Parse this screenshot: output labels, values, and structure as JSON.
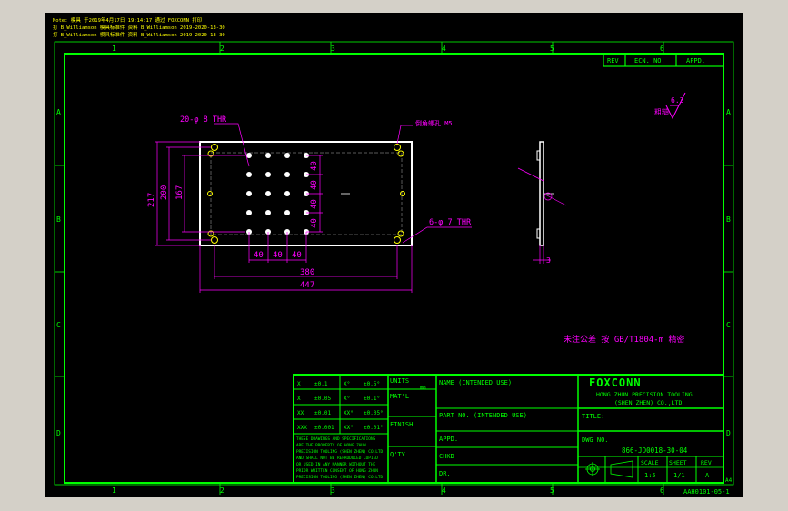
{
  "window": {
    "bg": "#d4d0c8",
    "canvas_bg": "#000000"
  },
  "colors": {
    "border": "#00ff00",
    "part": "#ffffff",
    "dim": "#ff00ff",
    "hole": "#ffff00"
  },
  "header_notes": [
    "Note: 模具 于2019年4月17日 19:14:17 通过 FOXCONN 打印",
    "打 B_Williamson 模具标准件 资料 B_Williamson 2019-2020-13-30",
    "打 B_Williamson 模具标准件 资料 B_Williamson 2019-2020-13-30"
  ],
  "zones": {
    "top": [
      "1",
      "2",
      "3",
      "4",
      "5",
      "6"
    ],
    "bottom": [
      "1",
      "2",
      "3",
      "4",
      "5",
      "6"
    ],
    "left": [
      "A",
      "B",
      "C",
      "D"
    ],
    "right": [
      "A",
      "B",
      "C",
      "D"
    ]
  },
  "revision_table": {
    "rev": "REV",
    "ecn": "ECN. NO.",
    "appd": "APPD."
  },
  "plan_view": {
    "thru_note": "20-φ 8 THR",
    "tap_note": "6-φ 7 THR",
    "corner_note": "倒角螺孔 M5",
    "vertical_dims": [
      "217",
      "200",
      "167"
    ],
    "pitch_v": [
      "40",
      "40",
      "40",
      "40"
    ],
    "pitch_h": [
      "40",
      "40",
      "40"
    ],
    "width_inner": "380",
    "width_outer": "447"
  },
  "side_view": {
    "thickness": "3"
  },
  "surface_finish": {
    "symbol_label": "粗糙",
    "value": "6.3"
  },
  "tech_note": "未注公差 按 GB/T1804-m 精密",
  "title_block": {
    "tol_rows": [
      [
        "X",
        "±0.1",
        "X°",
        "±0.5°"
      ],
      [
        "X",
        "±0.05",
        "X°",
        "±0.1°"
      ],
      [
        "XX",
        "±0.01",
        "XX°",
        "±0.05°"
      ],
      [
        "XXX",
        "±0.001",
        "XX°",
        "±0.01°"
      ]
    ],
    "units": "UNITS",
    "units_val": "mm",
    "matl": "MAT'L",
    "finish": "FINISH",
    "qty": "Q'TY",
    "notice": [
      "THESE DRAWINGS AND SPECIFICATIONS",
      "ARE THE PROPERTY OF HONG ZHUN",
      "PRECISION TOOLING (SHEN ZHEN) CO.LTD",
      "AND SHALL NOT BE REPRODUCED COPIED",
      "OR USED IN ANY MANNER WITHOUT THE",
      "PRIOR WRITTEN CONSENT OF HONG ZHUN",
      "PRECISION TOOLING (SHEN ZHEN) CO.LTD"
    ],
    "name_label": "NAME (INTENDED USE)",
    "part_no_label": "PART NO. (INTENDED USE)",
    "appd": "APPD.",
    "chkd": "CHKD",
    "dr": "DR.",
    "company_logo": "FOXCONN",
    "company_line1": "HONG ZHUN PRECISION TOOLING",
    "company_line2": "(SHEN ZHEN) CO.,LTD",
    "title_label": "TITLE:",
    "dwg_label": "DWG NO.",
    "dwg_no": "866-JD0018-30-04",
    "scale_label": "SCALE",
    "scale_val": "1:5",
    "sheet_label": "SHEET",
    "sheet_val": "1/1",
    "rev_label": "REV",
    "rev_val": "A",
    "size": "A4",
    "form_no": "AAH0101-05-1"
  }
}
